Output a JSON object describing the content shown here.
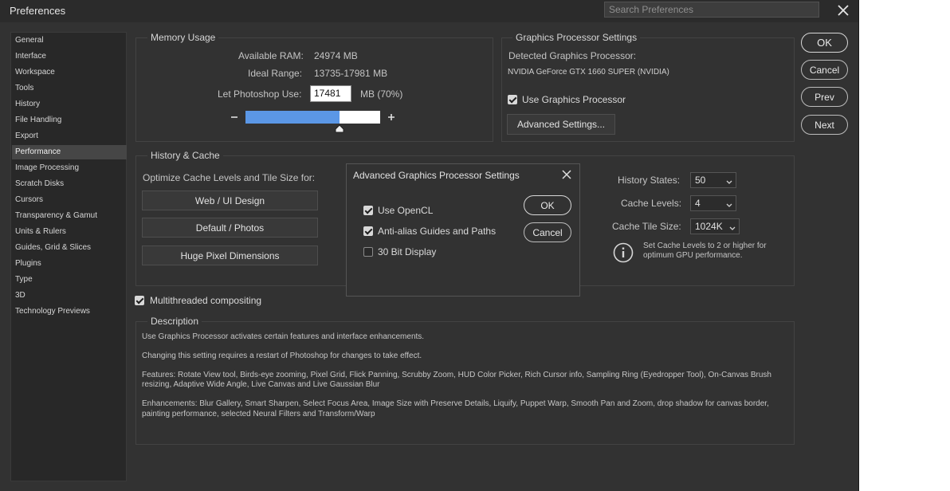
{
  "window": {
    "title": "Preferences",
    "search_placeholder": "Search Preferences"
  },
  "sidebar": {
    "items": [
      {
        "label": "General"
      },
      {
        "label": "Interface"
      },
      {
        "label": "Workspace"
      },
      {
        "label": "Tools"
      },
      {
        "label": "History"
      },
      {
        "label": "File Handling"
      },
      {
        "label": "Export"
      },
      {
        "label": "Performance",
        "active": true
      },
      {
        "label": "Image Processing"
      },
      {
        "label": "Scratch Disks"
      },
      {
        "label": "Cursors"
      },
      {
        "label": "Transparency & Gamut"
      },
      {
        "label": "Units & Rulers"
      },
      {
        "label": "Guides, Grid & Slices"
      },
      {
        "label": "Plugins"
      },
      {
        "label": "Type"
      },
      {
        "label": "3D"
      },
      {
        "label": "Technology Previews"
      }
    ]
  },
  "memory": {
    "title": "Memory Usage",
    "available_label": "Available RAM:",
    "available_value": "24974 MB",
    "ideal_label": "Ideal Range:",
    "ideal_value": "13735-17981 MB",
    "let_label": "Let Photoshop Use:",
    "let_value": "17481",
    "let_unit": "MB (70%)",
    "slider_fraction": 0.7
  },
  "gpu": {
    "title": "Graphics Processor Settings",
    "detected_label": "Detected Graphics Processor:",
    "detected_value": "NVIDIA GeForce GTX 1660 SUPER (NVIDIA)",
    "use_label": "Use Graphics Processor",
    "use_checked": true,
    "advanced_button": "Advanced Settings..."
  },
  "actions": {
    "ok": "OK",
    "cancel": "Cancel",
    "prev": "Prev",
    "next": "Next"
  },
  "history": {
    "title": "History & Cache",
    "optimize_label": "Optimize Cache Levels and Tile Size for:",
    "buttons": [
      "Web / UI Design",
      "Default / Photos",
      "Huge Pixel Dimensions"
    ],
    "states_label": "History States:",
    "states_value": "50",
    "levels_label": "Cache Levels:",
    "levels_value": "4",
    "tile_label": "Cache Tile Size:",
    "tile_value": "1024K",
    "info_line1": "Set Cache Levels to 2 or higher for",
    "info_line2": "optimum GPU performance."
  },
  "multithreaded": {
    "label": "Multithreaded compositing",
    "checked": true
  },
  "description": {
    "title": "Description",
    "p1": "Use Graphics Processor activates certain features and interface enhancements.",
    "p2": "Changing this setting requires a restart of Photoshop for changes to take effect.",
    "p3a": "Features: Rotate View tool, Birds-eye zooming, Pixel Grid, Flick Panning, Scrubby Zoom, HUD Color Picker, Rich Cursor info, Sampling Ring (Eyedropper Tool), On-Canvas Brush",
    "p3b": "resizing, Adaptive Wide Angle, Live Canvas and Live Gaussian Blur",
    "p4a": "Enhancements: Blur Gallery, Smart Sharpen, Select Focus Area, Image Size with Preserve Details, Liquify, Puppet Warp, Smooth Pan and Zoom, drop shadow for canvas border,",
    "p4b": "painting performance, selected Neural Filters and Transform/Warp"
  },
  "dialog": {
    "title": "Advanced Graphics Processor Settings",
    "opencl_label": "Use OpenCL",
    "opencl_checked": true,
    "antialias_label": "Anti-alias Guides and Paths",
    "antialias_checked": true,
    "bit30_label": "30 Bit Display",
    "bit30_checked": false,
    "ok": "OK",
    "cancel": "Cancel"
  },
  "colors": {
    "slider_fill": "#5b97e6",
    "panel_bg": "#323232",
    "sidebar_bg": "#282828",
    "active_item": "#464646"
  }
}
